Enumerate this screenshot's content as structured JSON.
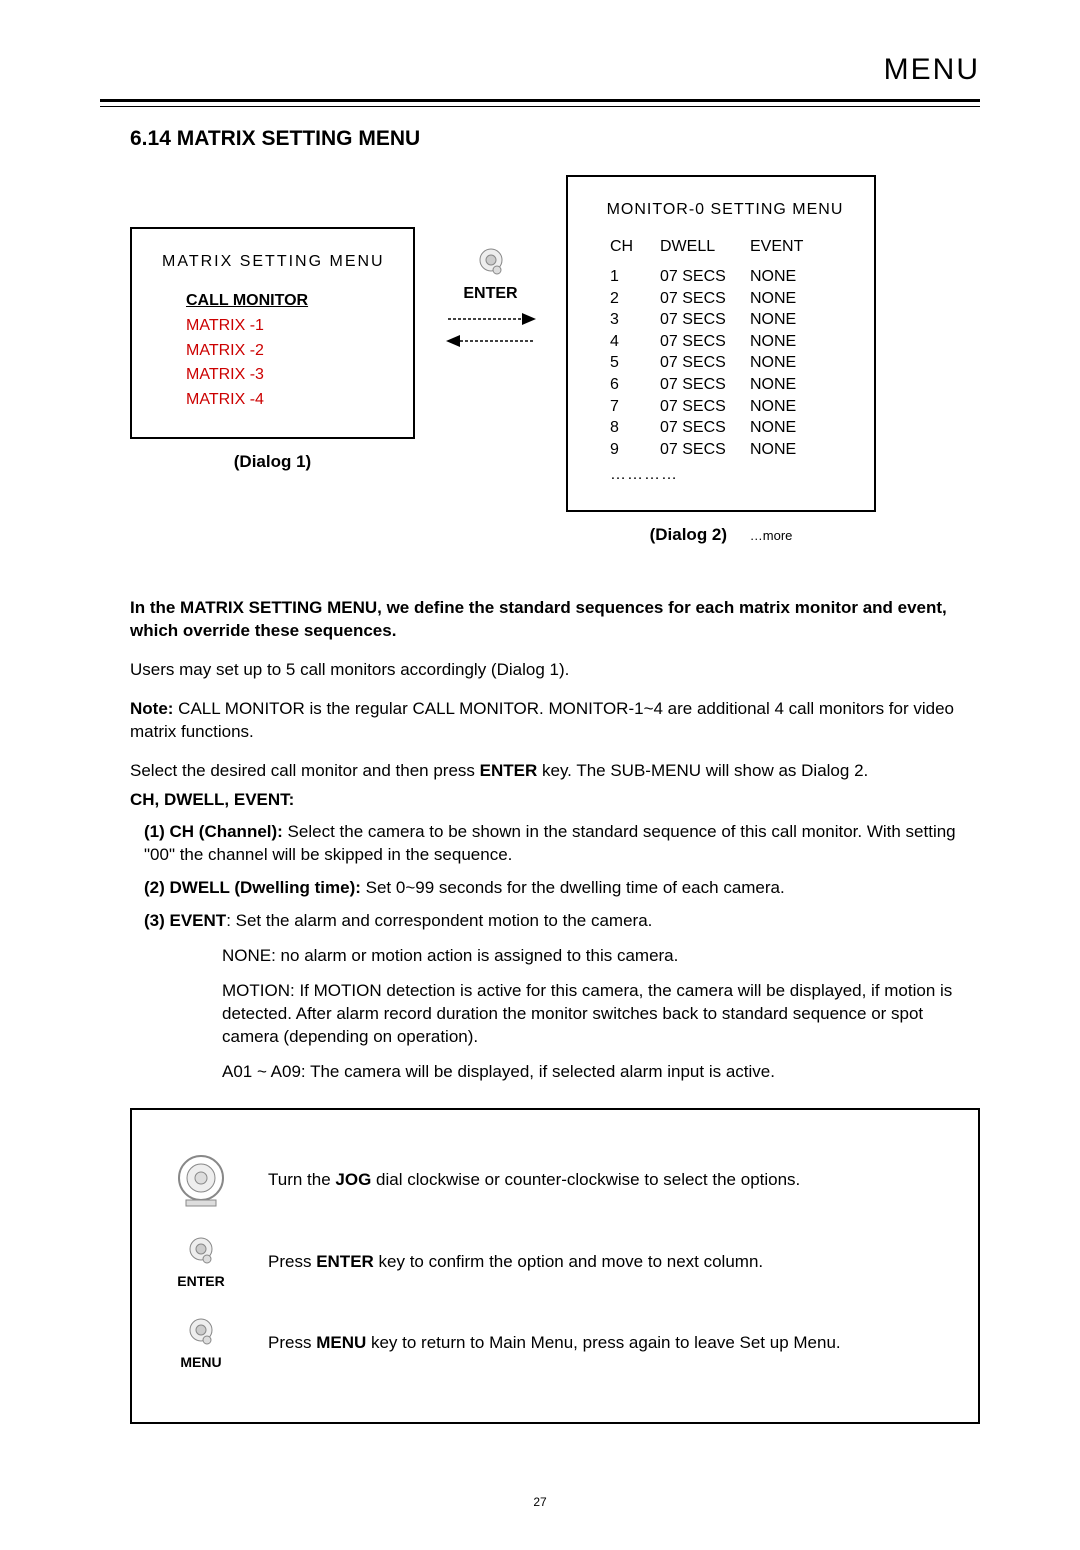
{
  "header": {
    "label": "MENU"
  },
  "section": {
    "number": "6.14",
    "title": "MATRIX SETTING MENU"
  },
  "dialog1": {
    "title": "MATRIX  SETTING MENU",
    "selected": "CALL MONITOR",
    "items": [
      "MATRIX -1",
      "MATRIX -2",
      "MATRIX -3",
      "MATRIX -4"
    ],
    "caption": "(Dialog 1)"
  },
  "enter_block": {
    "label": "ENTER"
  },
  "dialog2": {
    "title": "MONITOR-0  SETTING MENU",
    "head": [
      "CH",
      "DWELL",
      "EVENT"
    ],
    "rows": [
      {
        "ch": "1",
        "dwell": "07 SECS",
        "event": "NONE"
      },
      {
        "ch": "2",
        "dwell": "07 SECS",
        "event": "NONE"
      },
      {
        "ch": "3",
        "dwell": "07 SECS",
        "event": "NONE"
      },
      {
        "ch": "4",
        "dwell": "07 SECS",
        "event": "NONE"
      },
      {
        "ch": "5",
        "dwell": "07 SECS",
        "event": "NONE"
      },
      {
        "ch": "6",
        "dwell": "07 SECS",
        "event": "NONE"
      },
      {
        "ch": "7",
        "dwell": "07 SECS",
        "event": "NONE"
      },
      {
        "ch": "8",
        "dwell": "07 SECS",
        "event": "NONE"
      },
      {
        "ch": "9",
        "dwell": "07 SECS",
        "event": "NONE"
      }
    ],
    "ellipsis": "…………",
    "caption": "(Dialog 2)",
    "more": "…more"
  },
  "body": {
    "intro": "In the MATRIX SETTING MENU, we define the standard sequences for each matrix monitor and event, which override these sequences.",
    "users": "Users may set up to 5 call monitors accordingly (Dialog 1).",
    "note_label": "Note:",
    "note": " CALL MONITOR is the regular CALL MONITOR. MONITOR-1~4 are additional 4 call monitors for video matrix functions.",
    "select_pre": "Select the desired call monitor and then press ",
    "enter_key": "ENTER",
    "select_post": " key. The SUB-MENU will show as Dialog 2.",
    "subtitle": "CH, DWELL, EVENT:",
    "item1_label": "(1) CH (Channel):",
    "item1_text": " Select the camera to be shown in the standard sequence of this call monitor. With setting \"00\" the channel will be skipped in the sequence.",
    "item2_label": "(2) DWELL (Dwelling time):",
    "item2_text": " Set 0~99 seconds for the dwelling time of each camera.",
    "item3_label": "(3) EVENT",
    "item3_text": ": Set the alarm and correspondent motion to the camera.",
    "none_p": "NONE: no alarm or motion action is assigned to this camera.",
    "motion_p": "MOTION: If MOTION detection is active for this camera, the camera will be displayed, if motion is detected. After alarm record duration the monitor switches back to standard sequence or spot camera (depending on operation).",
    "a_p": "A01 ~ A09: The camera will be displayed, if selected alarm input is active."
  },
  "controls": {
    "jog_pre": "Turn the ",
    "jog_key": "JOG",
    "jog_post": " dial clockwise or counter-clockwise to select the options.",
    "enter_pre": "Press ",
    "enter_key": "ENTER",
    "enter_post": " key to confirm the option and move to next column.",
    "enter_label": "ENTER",
    "menu_pre": "Press ",
    "menu_key": "MENU",
    "menu_post": " key to return to Main Menu, press again to leave Set up Menu.",
    "menu_label": "MENU"
  },
  "page": "27"
}
